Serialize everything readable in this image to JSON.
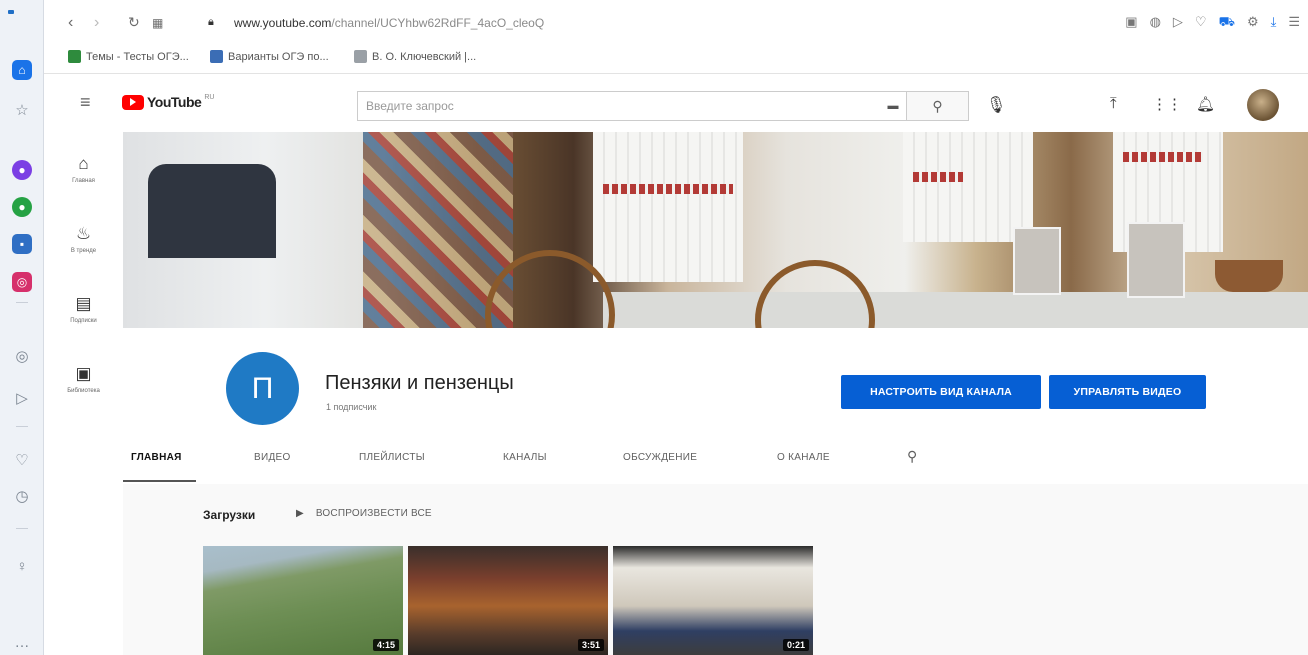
{
  "browser": {
    "url_domain": "www.youtube.com",
    "url_path": "/channel/UCYhbw62RdFF_4acO_cleoQ",
    "bookmarks": [
      {
        "label": "Темы - Тесты ОГЭ...",
        "color": "#2e8b3d"
      },
      {
        "label": "Варианты ОГЭ по...",
        "color": "#3b6db5"
      },
      {
        "label": "В. О. Ключевский |...",
        "color": "#9aa0a6"
      }
    ],
    "sidebar_icons": [
      "home-icon",
      "star-icon",
      "messenger-icon",
      "whatsapp-icon",
      "vk-icon",
      "instagram-icon",
      "history-icon",
      "send-icon",
      "heart-icon",
      "clock-icon",
      "bulb-icon",
      "more-icon"
    ]
  },
  "youtube": {
    "logo_text": "YouTube",
    "logo_region": "RU",
    "search_placeholder": "Введите запрос",
    "guide": [
      {
        "label": "Главная",
        "icon": "home-icon"
      },
      {
        "label": "В тренде",
        "icon": "trending-icon"
      },
      {
        "label": "Подписки",
        "icon": "subscriptions-icon"
      },
      {
        "label": "Библиотека",
        "icon": "library-icon"
      }
    ]
  },
  "channel": {
    "avatar_letter": "П",
    "name": "Пензяки и пензенцы",
    "subscribers": "1 подписчик",
    "customize_button": "НАСТРОИТЬ ВИД КАНАЛА",
    "manage_button": "УПРАВЛЯТЬ ВИДЕО",
    "accent_color": "#065fd4",
    "tabs": [
      "ГЛАВНАЯ",
      "ВИДЕО",
      "ПЛЕЙЛИСТЫ",
      "КАНАЛЫ",
      "ОБСУЖДЕНИЕ",
      "О КАНАЛЕ"
    ],
    "active_tab": "ГЛАВНАЯ"
  },
  "shelf": {
    "title": "Загрузки",
    "play_all": "ВОСПРОИЗВЕСТИ ВСЕ",
    "videos": [
      {
        "duration": "4:15"
      },
      {
        "duration": "3:51"
      },
      {
        "duration": "0:21"
      }
    ]
  }
}
